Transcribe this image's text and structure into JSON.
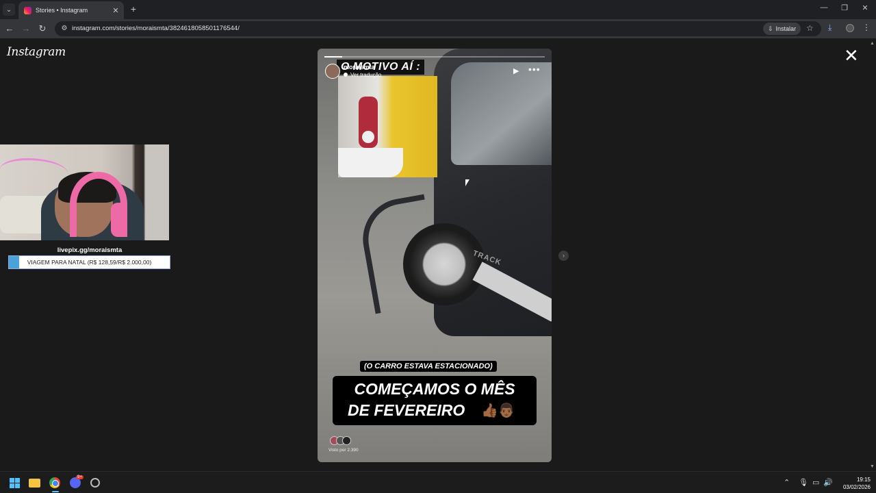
{
  "browser": {
    "tab_title": "Stories • Instagram",
    "url": "instagram.com/stories/moraismta/3824618058501176544/",
    "install_label": "Instalar"
  },
  "page": {
    "logo": "Instagram"
  },
  "overlay": {
    "livepix": "livepix.gg/moraismta",
    "goal_text": "VIAGEM PARA NATAL (R$ 128,59/R$ 2.000,00)",
    "goal_progress": 0.064
  },
  "story": {
    "username": "moraismta",
    "translate": "Ver tradução",
    "headline": "O MOTIVO AÍ :",
    "car_badge": "TRACK",
    "caption_small": "(O CARRO ESTAVA ESTACIONADO)",
    "caption_line1": "COMEÇAMOS O MÊS",
    "caption_line2": "DE FEVEREIRO",
    "caption_emoji": "👍🏾👨🏾",
    "seen_by": "Visto por 2.390",
    "progress": 0.08
  },
  "taskbar": {
    "discord_badge": "9+",
    "time": "19:15",
    "date": "03/02/2026"
  },
  "icons": {
    "win_accent": "#4cc2ff",
    "ig_gradient": [
      "#f9a825",
      "#e91e63",
      "#8e24aa"
    ]
  }
}
